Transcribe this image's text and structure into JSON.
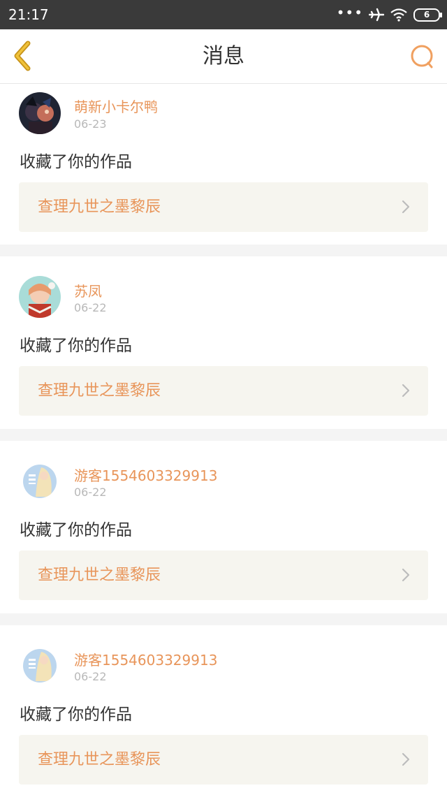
{
  "status_bar": {
    "time": "21:17",
    "dots": "•••",
    "battery": "6"
  },
  "nav": {
    "title": "消息",
    "back_icon": "chevron-left-icon",
    "search_icon": "search-icon"
  },
  "colors": {
    "accent": "#e8955a",
    "back_icon": "#d8a018",
    "card_link_bg": "#f6f5ef"
  },
  "messages": [
    {
      "user": "萌新小卡尔鸭",
      "date": "06-23",
      "action": "收藏了你的作品",
      "work": "查理九世之墨黎辰"
    },
    {
      "user": "苏凤",
      "date": "06-22",
      "action": "收藏了你的作品",
      "work": "查理九世之墨黎辰"
    },
    {
      "user": "游客1554603329913",
      "date": "06-22",
      "action": "收藏了你的作品",
      "work": "查理九世之墨黎辰"
    },
    {
      "user": "游客1554603329913",
      "date": "06-22",
      "action": "收藏了你的作品",
      "work": "查理九世之墨黎辰"
    }
  ]
}
